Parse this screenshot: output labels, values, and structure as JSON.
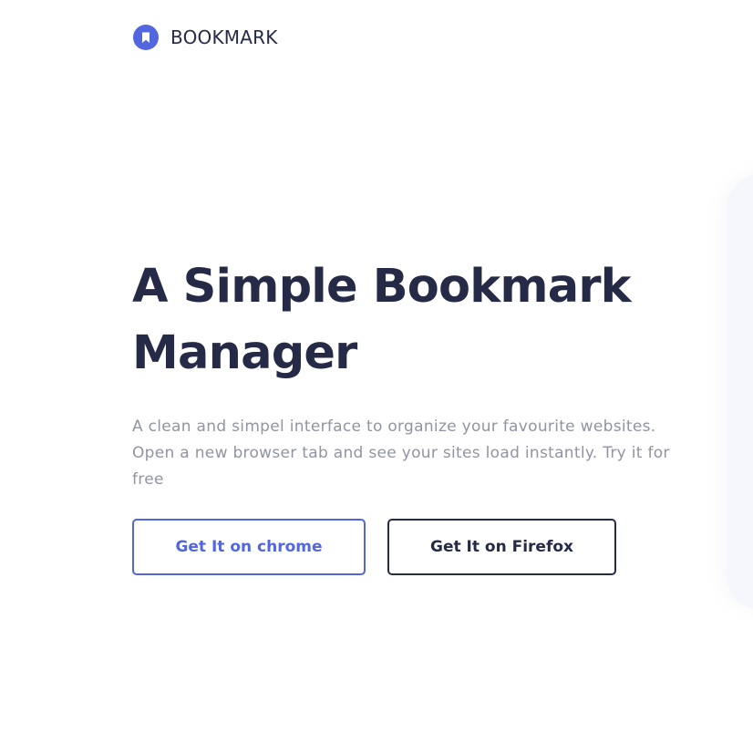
{
  "header": {
    "logo_icon": "bookmark-icon",
    "brand_name": "BOOKMARK"
  },
  "hero": {
    "title": "A Simple Bookmark Manager",
    "description": "A clean and simpel interface to organize your favourite websites. Open a new browser tab and see your sites load instantly. Try it for free",
    "buttons": {
      "chrome_label": "Get It on chrome",
      "firefox_label": "Get It on Firefox"
    }
  },
  "colors": {
    "accent": "#5267df",
    "text_dark": "#252b46",
    "text_muted": "#9194a2",
    "background": "#ffffff"
  }
}
